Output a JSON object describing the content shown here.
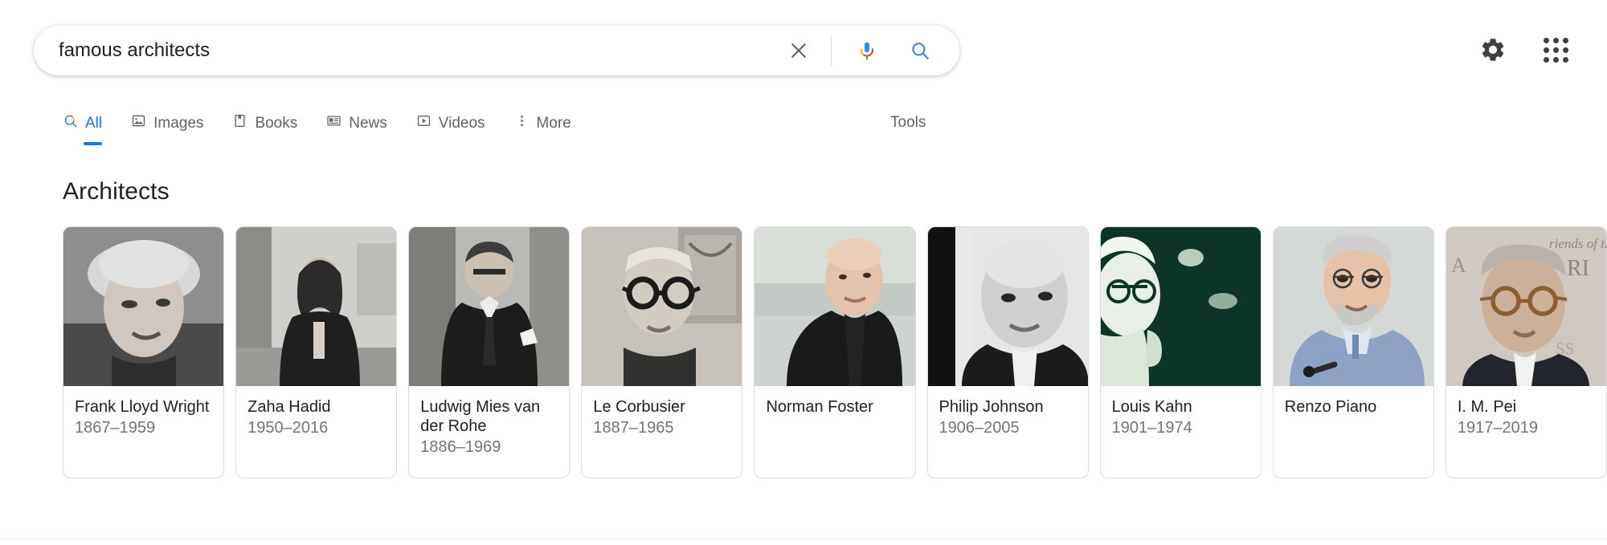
{
  "search": {
    "query": "famous architects",
    "placeholder": "Search",
    "clear_label": "Clear",
    "mic_label": "Search by voice",
    "search_label": "Google Search"
  },
  "header": {
    "settings_label": "Settings",
    "apps_label": "Google apps"
  },
  "nav": {
    "tabs": [
      {
        "label": "All",
        "icon": "google-search-icon",
        "active": true
      },
      {
        "label": "Images",
        "icon": "image-icon",
        "active": false
      },
      {
        "label": "Books",
        "icon": "book-icon",
        "active": false
      },
      {
        "label": "News",
        "icon": "newspaper-icon",
        "active": false
      },
      {
        "label": "Videos",
        "icon": "video-icon",
        "active": false
      },
      {
        "label": "More",
        "icon": "more-vertical-icon",
        "active": false
      }
    ],
    "tools_label": "Tools"
  },
  "results": {
    "section_title": "Architects",
    "cards": [
      {
        "name": "Frank Lloyd Wright",
        "years": "1867–1959"
      },
      {
        "name": "Zaha Hadid",
        "years": "1950–2016"
      },
      {
        "name": "Ludwig Mies van der Rohe",
        "years": "1886–1969"
      },
      {
        "name": "Le Corbusier",
        "years": "1887–1965"
      },
      {
        "name": "Norman Foster",
        "years": ""
      },
      {
        "name": "Philip Johnson",
        "years": "1906–2005"
      },
      {
        "name": "Louis Kahn",
        "years": "1901–1974"
      },
      {
        "name": "Renzo Piano",
        "years": ""
      },
      {
        "name": "I. M. Pei",
        "years": "1917–2019"
      }
    ]
  },
  "colors": {
    "accent_blue": "#1a73e8",
    "text_primary": "#202124",
    "text_secondary": "#70757a",
    "border": "#dadce0",
    "google_red": "#ea4335",
    "google_yellow": "#fbbc05",
    "google_green": "#34a853"
  }
}
